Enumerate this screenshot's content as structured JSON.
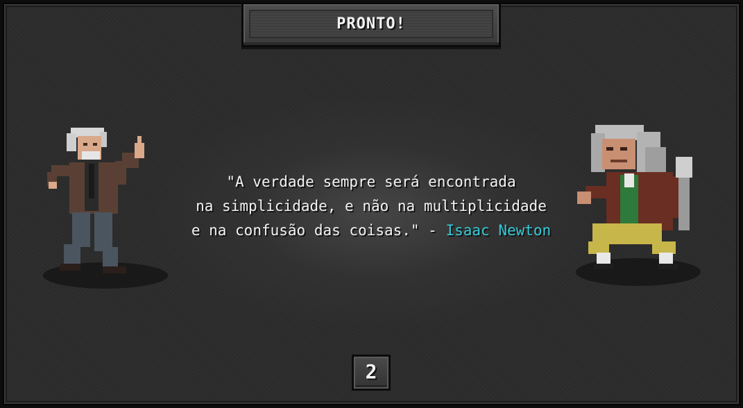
{
  "banner": {
    "label": "PRONTO!"
  },
  "quote": {
    "line1": "\"A verdade sempre será encontrada",
    "line2": "na simplicidade, e não na multiplicidade",
    "line3_text": "e na confusão das coisas.\" - ",
    "author": "Isaac Newton"
  },
  "countdown": {
    "value": "2"
  },
  "colors": {
    "author_accent": "#35c9d6",
    "background": "#2c2c2c"
  },
  "characters": {
    "left": "old-scientist-fighter-icon",
    "right": "isaac-newton-fighter-icon"
  }
}
